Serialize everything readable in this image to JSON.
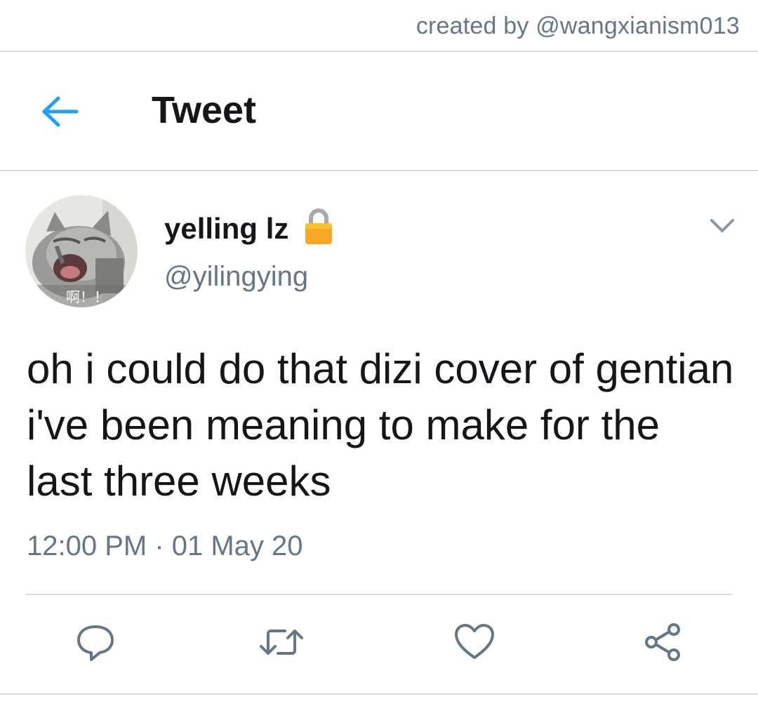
{
  "credit": "created by @wangxianism013",
  "header": {
    "title": "Tweet",
    "back_icon": "arrow-left-icon"
  },
  "tweet": {
    "author": {
      "display_name": "yelling lz",
      "handle": "@yilingying",
      "locked_icon": "lock-icon",
      "avatar_caption": "啊！！"
    },
    "text": "oh i could do that dizi cover of gentian i've been meaning to make for the last three weeks",
    "timestamp": "12:00 PM · 01 May 20",
    "menu_icon": "chevron-down-icon"
  },
  "actions": [
    {
      "name": "reply",
      "icon": "speech-bubble-icon"
    },
    {
      "name": "retweet",
      "icon": "retweet-icon"
    },
    {
      "name": "like",
      "icon": "heart-icon"
    },
    {
      "name": "share",
      "icon": "share-icon"
    }
  ],
  "colors": {
    "accent": "#1da1f2",
    "text_primary": "#14171a",
    "text_secondary": "#657786",
    "divider": "#d6dce1",
    "lock_body": "#f9a825"
  }
}
